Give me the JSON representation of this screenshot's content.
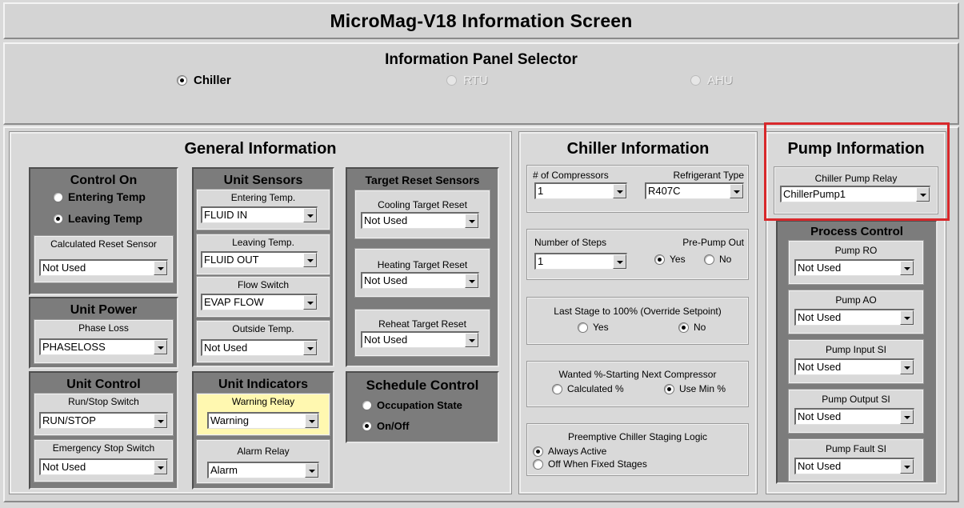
{
  "title": "MicroMag-V18 Information Screen",
  "selector": {
    "title": "Information Panel Selector",
    "options": [
      {
        "label": "Chiller",
        "selected": true,
        "enabled": true
      },
      {
        "label": "RTU",
        "selected": false,
        "enabled": false
      },
      {
        "label": "AHU",
        "selected": false,
        "enabled": false
      }
    ]
  },
  "general": {
    "title": "General Information",
    "control_on": {
      "title": "Control On",
      "options": [
        {
          "label": "Entering Temp",
          "selected": false
        },
        {
          "label": "Leaving Temp",
          "selected": true
        }
      ],
      "reset_sensor": {
        "label": "Calculated Reset Sensor",
        "value": "Not Used"
      }
    },
    "unit_power": {
      "title": "Unit Power",
      "phase_loss": {
        "label": "Phase Loss",
        "value": "PHASELOSS"
      }
    },
    "unit_control": {
      "title": "Unit Control",
      "run_stop": {
        "label": "Run/Stop Switch",
        "value": "RUN/STOP"
      },
      "estop": {
        "label": "Emergency Stop Switch",
        "value": "Not Used"
      }
    },
    "unit_sensors": {
      "title": "Unit Sensors",
      "entering": {
        "label": "Entering Temp.",
        "value": "FLUID IN"
      },
      "leaving": {
        "label": "Leaving Temp.",
        "value": "FLUID OUT"
      },
      "flow": {
        "label": "Flow Switch",
        "value": "EVAP FLOW"
      },
      "outside": {
        "label": "Outside Temp.",
        "value": "Not Used"
      }
    },
    "unit_indicators": {
      "title": "Unit Indicators",
      "warning": {
        "label": "Warning Relay",
        "value": "Warning"
      },
      "alarm": {
        "label": "Alarm Relay",
        "value": "Alarm"
      }
    },
    "target_reset": {
      "title": "Target Reset Sensors",
      "cooling": {
        "label": "Cooling Target Reset",
        "value": "Not Used"
      },
      "heating": {
        "label": "Heating Target Reset",
        "value": "Not Used"
      },
      "reheat": {
        "label": "Reheat Target Reset",
        "value": "Not Used"
      }
    },
    "schedule": {
      "title": "Schedule Control",
      "options": [
        {
          "label": "Occupation State",
          "selected": false
        },
        {
          "label": "On/Off",
          "selected": true
        }
      ]
    }
  },
  "chiller": {
    "title": "Chiller Information",
    "compressors": {
      "label": "# of Compressors",
      "value": "1"
    },
    "refrigerant": {
      "label": "Refrigerant Type",
      "value": "R407C"
    },
    "steps": {
      "label": "Number of Steps",
      "value": "1"
    },
    "prepump": {
      "label": "Pre-Pump Out",
      "yes": "Yes",
      "no": "No",
      "selected": "yes"
    },
    "last_stage": {
      "label": "Last Stage to 100% (Override Setpoint)",
      "yes": "Yes",
      "no": "No",
      "selected": "no"
    },
    "wanted": {
      "label": "Wanted %-Starting Next Compressor",
      "opt1": "Calculated %",
      "opt2": "Use Min %",
      "selected": "opt2"
    },
    "preemptive": {
      "label": "Preemptive Chiller Staging Logic",
      "opt1": "Always Active",
      "opt2": "Off When Fixed Stages",
      "selected": "opt1"
    }
  },
  "pump": {
    "title": "Pump Information",
    "relay": {
      "label": "Chiller Pump Relay",
      "value": "ChillerPump1"
    },
    "process": {
      "title": "Process Control",
      "ro": {
        "label": "Pump RO",
        "value": "Not Used"
      },
      "ao": {
        "label": "Pump AO",
        "value": "Not Used"
      },
      "input": {
        "label": "Pump Input SI",
        "value": "Not Used"
      },
      "output": {
        "label": "Pump Output SI",
        "value": "Not Used"
      },
      "fault": {
        "label": "Pump Fault SI",
        "value": "Not Used"
      }
    }
  },
  "colors": {
    "highlight": "#d8282b",
    "panel_dark": "#7c7c7c",
    "warning_bg": "#fff8b0"
  }
}
